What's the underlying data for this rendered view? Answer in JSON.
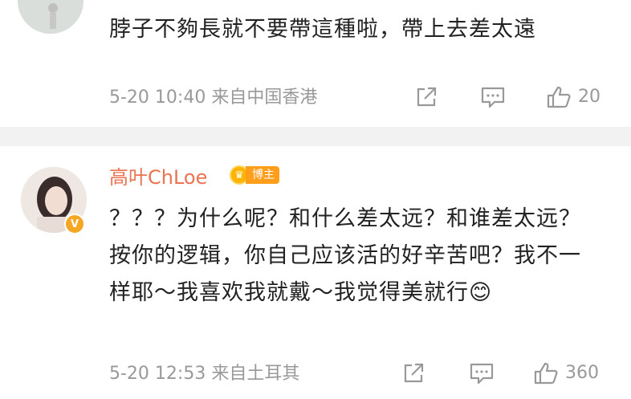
{
  "comments": [
    {
      "text": "脖子不夠長就不要帶這種啦，帶上去差太遠",
      "time": "5-20 10:40",
      "location": "来自中国香港",
      "likes": "20",
      "avatar_icon": "user-avatar-photo"
    },
    {
      "username": "高叶ChLoe",
      "badge": "博主",
      "text": "？？？为什么呢？和什么差太远？和谁差太远？按你的逻辑，你自己应该活的好辛苦吧？我不一样耶～我喜欢我就戴～我觉得美就行😊",
      "time": "5-20 12:53",
      "location": "来自土耳其",
      "likes": "360",
      "avatar_icon": "user-avatar-photo",
      "verified_icon": "verified-badge-icon"
    }
  ],
  "colors": {
    "username": "#eb7350",
    "meta_text": "#999999",
    "badge": "#ff9e1b",
    "verified": "#f5a623",
    "divider": "#f2f2f2"
  }
}
